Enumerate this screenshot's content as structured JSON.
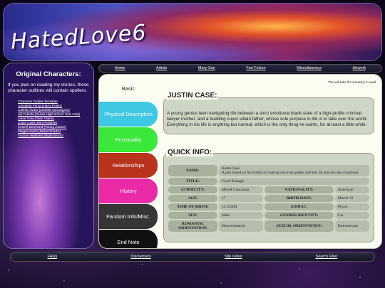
{
  "banner": {
    "title": "HatedLove6"
  },
  "left_panel": {
    "heading": "Original Characters:",
    "intro": "If you plan on reading my stories, these character outlines will contain spoilers.",
    "characters": [
      "Character Outline Template",
      "Adrastela Penta (Harry Potter)",
      "Cafelia Alvaro (Zombie Apocalypse)",
      "Aiji Fukuda (Ouran High School Host Club)",
      "Jared Gray (Teen Titans)",
      "Justin Case (Kim Possible)",
      "Kestrel Desmond (Young Justice)",
      "Magpie Kwon (Street Sharks)",
      "Yvonne Heathers (Night Baron)"
    ]
  },
  "top_nav": [
    "Home",
    "Artists",
    "Mary-Sue",
    "Fan Fiction",
    "Miscellaneous",
    "Artwork"
  ],
  "tabs": [
    "Basic",
    "Physical Description",
    "Personality",
    "Relationships",
    "History",
    "Fandom Info/Misc.",
    "End Note"
  ],
  "read_time": "This will take 20 minute(s) to read",
  "char": {
    "title": "JUSTIN CASE:",
    "description": "A young genius teen navigating life between a strict emotional blank-slate of a high-profile criminal lawyer mother, and a budding super-villain father, whose sole purpose in life is to take over the world. Everything in his life is anything but normal, which is the only thing he wants, for at least a little while."
  },
  "quick_info": {
    "title": "QUICK INFO:",
    "name_label": "NAME:",
    "name_value": "Justin Case",
    "name_sub": "A pun based on his hobby of making survival guides and kits for just-in-case situations.",
    "title_label": "TITLE:",
    "title_value": "Good Enough",
    "ethnicity_label": "ETHNICITY:",
    "ethnicity_value": "Mixed Caucasian",
    "nationality_label": "NATIONALITY:",
    "nationality_value": "American",
    "age_label": "AGE:",
    "age_value": "17",
    "birthdate_label": "BIRTH-DATE:",
    "birthdate_value": "March 10",
    "tob_label": "TIME OF BIRTH:",
    "tob_value": "11:34AM",
    "zodiac_label": "ZODIAC:",
    "zodiac_value": "Pisces",
    "sex_label": "SEX:",
    "sex_value": "Male",
    "gender_label": "GENDER IDENTITY:",
    "gender_value": "Cis",
    "romantic_label": "ROMANTIC ORIENTATION:",
    "romantic_value": "Homoromantic",
    "sexual_label": "SEXUAL ORIENTATION:",
    "sexual_value": "Homosexual"
  },
  "bottom_nav": [
    "FAQs",
    "Disclaimers",
    "Site Index",
    "Search Filler"
  ]
}
